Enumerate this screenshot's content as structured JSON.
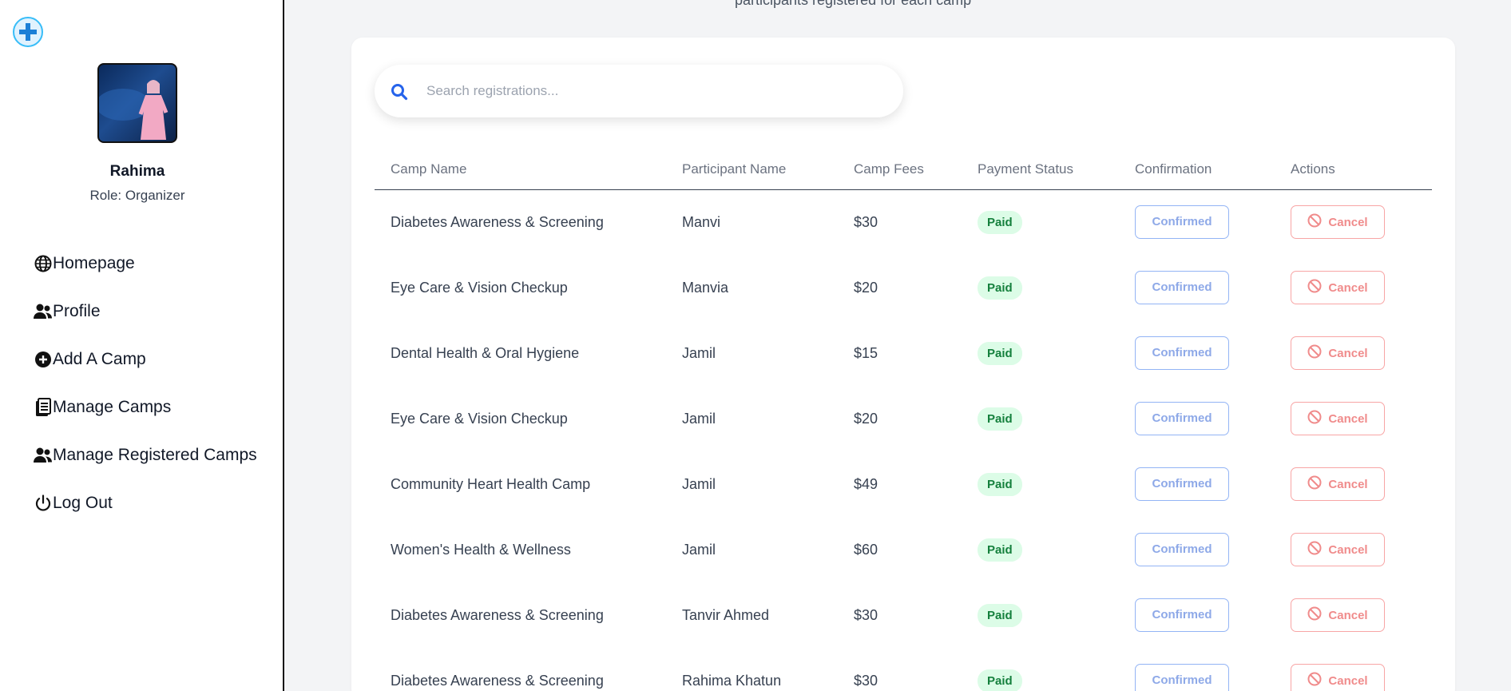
{
  "header": {
    "partial_text": "participants registered for each camp"
  },
  "sidebar": {
    "user": {
      "name": "Rahima",
      "role": "Role: Organizer"
    },
    "items": [
      {
        "label": "Homepage",
        "icon": "globe-icon"
      },
      {
        "label": "Profile",
        "icon": "users-icon"
      },
      {
        "label": "Add A Camp",
        "icon": "plus-circle-icon"
      },
      {
        "label": "Manage Camps",
        "icon": "clipboard-icon"
      },
      {
        "label": "Manage Registered Camps",
        "icon": "users-icon"
      },
      {
        "label": "Log Out",
        "icon": "power-icon"
      }
    ]
  },
  "search": {
    "placeholder": "Search registrations..."
  },
  "table": {
    "columns": [
      "Camp Name",
      "Participant Name",
      "Camp Fees",
      "Payment Status",
      "Confirmation",
      "Actions"
    ],
    "rows": [
      {
        "camp": "Diabetes Awareness & Screening",
        "participant": "Manvi",
        "fee": "$30",
        "payment": "Paid",
        "confirmation": "Confirmed",
        "action": "Cancel"
      },
      {
        "camp": "Eye Care & Vision Checkup",
        "participant": "Manvia",
        "fee": "$20",
        "payment": "Paid",
        "confirmation": "Confirmed",
        "action": "Cancel"
      },
      {
        "camp": "Dental Health & Oral Hygiene",
        "participant": "Jamil",
        "fee": "$15",
        "payment": "Paid",
        "confirmation": "Confirmed",
        "action": "Cancel"
      },
      {
        "camp": "Eye Care & Vision Checkup",
        "participant": "Jamil",
        "fee": "$20",
        "payment": "Paid",
        "confirmation": "Confirmed",
        "action": "Cancel"
      },
      {
        "camp": "Community Heart Health Camp",
        "participant": "Jamil",
        "fee": "$49",
        "payment": "Paid",
        "confirmation": "Confirmed",
        "action": "Cancel"
      },
      {
        "camp": "Women's Health & Wellness",
        "participant": "Jamil",
        "fee": "$60",
        "payment": "Paid",
        "confirmation": "Confirmed",
        "action": "Cancel"
      },
      {
        "camp": "Diabetes Awareness & Screening",
        "participant": "Tanvir Ahmed",
        "fee": "$30",
        "payment": "Paid",
        "confirmation": "Confirmed",
        "action": "Cancel"
      },
      {
        "camp": "Diabetes Awareness & Screening",
        "participant": "Rahima Khatun",
        "fee": "$30",
        "payment": "Paid",
        "confirmation": "Confirmed",
        "action": "Cancel"
      }
    ]
  },
  "colors": {
    "paid_bg": "#dcfce7",
    "paid_text": "#15803d",
    "confirm": "#8ea9e8",
    "cancel": "#f08b8b",
    "search_icon": "#2563eb"
  }
}
